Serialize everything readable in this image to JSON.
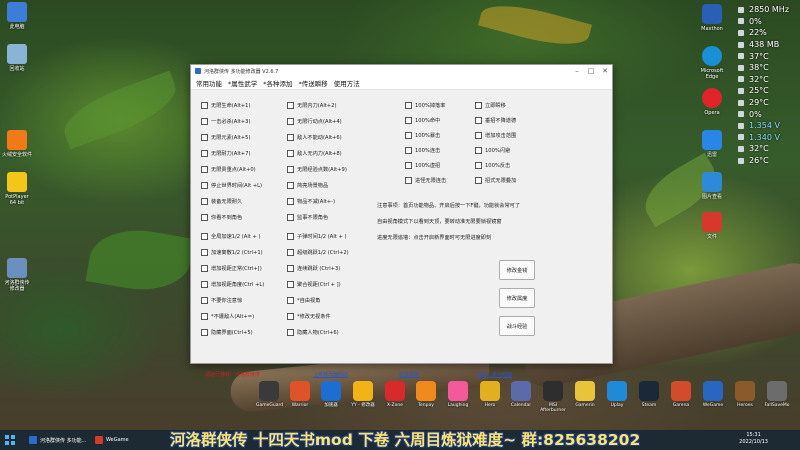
{
  "desktop": {
    "icons_left": [
      {
        "label": "此电脑",
        "icon": "computer-icon",
        "color": "#3d7dd8"
      },
      {
        "label": "回收站",
        "icon": "recycle-bin-icon",
        "color": "#8ab4d6"
      },
      {
        "label": "火绒安全软件",
        "icon": "huorong-icon",
        "color": "#f07a1a"
      },
      {
        "label": "PotPlayer 64 bit",
        "icon": "potplayer-icon",
        "color": "#f3c61a"
      },
      {
        "label": "河洛群侠传 修改器",
        "icon": "trainer-icon",
        "color": "#6b8fbf"
      }
    ],
    "icons_right": [
      {
        "label": "Maxthon",
        "icon": "maxthon-icon",
        "color": "#2a5fb5"
      },
      {
        "label": "Microsoft Edge",
        "icon": "edge-icon",
        "color": "#1a8fd6"
      },
      {
        "label": "Opera",
        "icon": "opera-icon",
        "color": "#e0242b"
      },
      {
        "label": "迅雷",
        "icon": "xunlei-icon",
        "color": "#2a86e6"
      },
      {
        "label": "图片查看",
        "icon": "photo-icon",
        "color": "#2d8ad8"
      },
      {
        "label": "文件",
        "icon": "file-icon",
        "color": "#d6392b"
      }
    ]
  },
  "sysmon": [
    {
      "value": "2850 MHz",
      "color": "#ffffff"
    },
    {
      "value": "0%",
      "color": "#ffffff"
    },
    {
      "value": "22%",
      "color": "#ffffff"
    },
    {
      "value": "438 MB",
      "color": "#ffffff"
    },
    {
      "value": "37°C",
      "color": "#ffffff"
    },
    {
      "value": "38°C",
      "color": "#ffffff"
    },
    {
      "value": "32°C",
      "color": "#ffffff"
    },
    {
      "value": "25°C",
      "color": "#ffffff"
    },
    {
      "value": "29°C",
      "color": "#ffffff"
    },
    {
      "value": "0%",
      "color": "#ffffff"
    },
    {
      "value": "1.354 V",
      "color": "#7fd7ff"
    },
    {
      "value": "1.340 V",
      "color": "#7fd7ff"
    },
    {
      "value": "32°C",
      "color": "#ffffff"
    },
    {
      "value": "26°C",
      "color": "#ffffff"
    }
  ],
  "window": {
    "title": "河洛群侠传 多功能修改器 V2.6.7",
    "menu": [
      "常用功能",
      "属性武学",
      "各种添加",
      "传送瞬移",
      "使用方法"
    ],
    "col1": [
      "无限生命(Alt+1)",
      "一击必杀(Alt+3)",
      "无限元素(Alt+5)",
      "无限耐力(Alt+7)",
      "无限贵重点(Alt+0)",
      "停止世界时间(Alt +L)",
      "装备无限耐久",
      "你看不到角色",
      "全局加速1/2 (Alt + )",
      "加速离散1/2 (Ctrl+1)",
      "增加视距正常(Ctrl+[)",
      "增加视距角度(Ctrl +L)",
      "不要你注意惊",
      "*不遭敌人(Alt+=)",
      "隐藏界面(Ctrl+5)"
    ],
    "col2": [
      "无限内力(Alt+2)",
      "无限行动点(Alt+4)",
      "敌人不能动(Alt+6)",
      "敌人无内力(Alt+8)",
      "无限经验点数(Alt+9)",
      "简亮场景物品",
      "物品不减(Alt+-)",
      "监事不限角色",
      "子弹时间1/2 (Alt + )",
      "超级跳跃1/2 (Ctrl+2)",
      "连续跳跃 (Ctrl+3)",
      "聚合视距(Ctrl + ])",
      "*自由视角",
      "*修改无视条件",
      "隐藏人物(Ctrl+6)"
    ],
    "col3": [
      "100%掉落率",
      "100%命中",
      "100%暴击",
      "100%连击",
      "100%虚招",
      "进怪无限连击"
    ],
    "col4": [
      "立即瞬移",
      "垂招不降道德",
      "增加攻击范围",
      "100%闪避",
      "100%反击",
      "招式无限叠加"
    ],
    "notes": [
      "注意事项：首页功能物品、开启后按一下F键，功能就会常可了",
      "自由视角模式下以看到天顶，要转动准无限要锁视镜窗",
      "进度无限追墙：点击开启新界面时可无限进度即刻"
    ],
    "buttons": [
      "修改金钱",
      "修改属度",
      "战斗经验"
    ],
    "footer": {
      "notice": "请运行游戏：河洛群侠传",
      "link1": "上传修改器网站",
      "link2": "检查更新",
      "link3": "作者：多少暗面"
    }
  },
  "taskbar_icons": [
    {
      "label": "GameGuard",
      "color": "#3a3a3a"
    },
    {
      "label": "Warrior",
      "color": "#e0522a"
    },
    {
      "label": "加速器",
      "color": "#1c6fd1"
    },
    {
      "label": "YY - 修改器",
      "color": "#f2b316"
    },
    {
      "label": "X-Zone",
      "color": "#d8292b"
    },
    {
      "label": "Tenpay",
      "color": "#f08a1e"
    },
    {
      "label": "Laughing",
      "color": "#f25a9b"
    },
    {
      "label": "Hero",
      "color": "#e1b020"
    },
    {
      "label": "Calendar",
      "color": "#5b6aa8"
    },
    {
      "label": "MSI Afterburner",
      "color": "#2e2e2e"
    },
    {
      "label": "Gamerin",
      "color": "#e7c43a"
    },
    {
      "label": "Uplay",
      "color": "#1f8ad8"
    },
    {
      "label": "Steam",
      "color": "#1b2838"
    },
    {
      "label": "Garena",
      "color": "#d24b2b"
    },
    {
      "label": "WeGame",
      "color": "#2767c2"
    },
    {
      "label": "Heroes",
      "color": "#8b5a2b"
    },
    {
      "label": "FallSaveMo",
      "color": "#6c6c6c"
    }
  ],
  "taskbar": {
    "task1": "河洛群侠传 多功能...",
    "task2": "WeGame",
    "subtitle": "河洛群侠传  十四天书mod 下卷  六周目炼狱难度~  群:825638202",
    "time": "15:31",
    "date": "2022/10/13"
  },
  "colors": {
    "accent": "#2a55c8",
    "warning": "#d21f1f",
    "banner_text": "#ffe36a"
  }
}
